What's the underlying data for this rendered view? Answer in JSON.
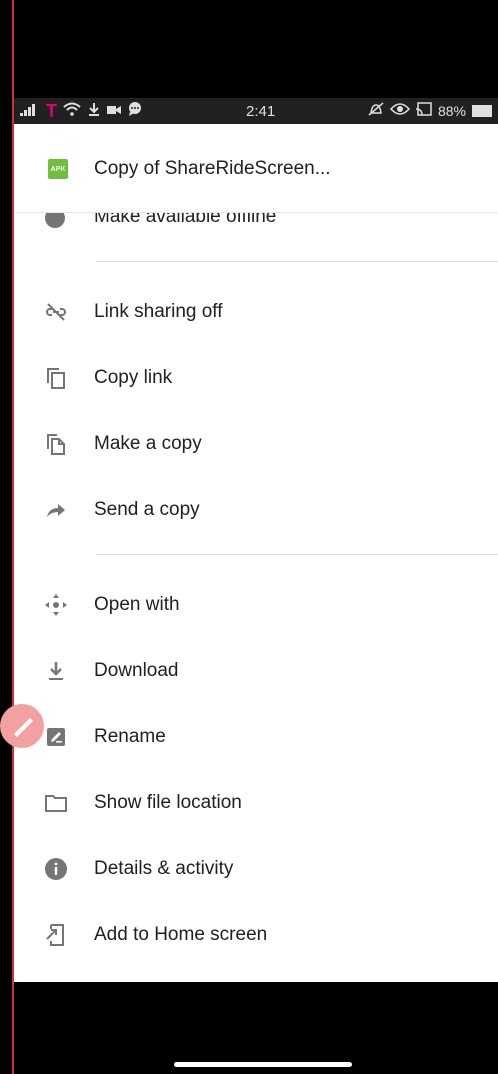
{
  "status_bar": {
    "carrier": "T",
    "time": "2:41",
    "battery": "88%",
    "left_icons": [
      "signal-icon",
      "wifi-icon",
      "download-icon",
      "video-icon",
      "chat-icon"
    ],
    "right_icons": [
      "mute-icon",
      "eye-icon",
      "cast-icon",
      "battery-icon"
    ]
  },
  "sheet": {
    "file_badge": "APK",
    "file_name": "Copy of ShareRideScreen...",
    "partial_item_label": "Make available offline"
  },
  "menu": {
    "groups": [
      [
        {
          "label": "Link sharing off",
          "icon": "link-off-icon"
        },
        {
          "label": "Copy link",
          "icon": "copy-icon"
        },
        {
          "label": "Make a copy",
          "icon": "document-copy-icon"
        },
        {
          "label": "Send a copy",
          "icon": "forward-arrow-icon"
        }
      ],
      [
        {
          "label": "Open with",
          "icon": "move-arrows-icon"
        },
        {
          "label": "Download",
          "icon": "download-icon"
        },
        {
          "label": "Rename",
          "icon": "rename-pencil-icon"
        },
        {
          "label": "Show file location",
          "icon": "folder-icon"
        },
        {
          "label": "Details & activity",
          "icon": "info-icon"
        },
        {
          "label": "Add to Home screen",
          "icon": "add-to-home-icon"
        }
      ]
    ]
  },
  "colors": {
    "accent_pink": "#e20074",
    "apk_green": "#6fbf3c",
    "fab_pink": "#f2a0a0",
    "icon_gray": "#757575"
  }
}
